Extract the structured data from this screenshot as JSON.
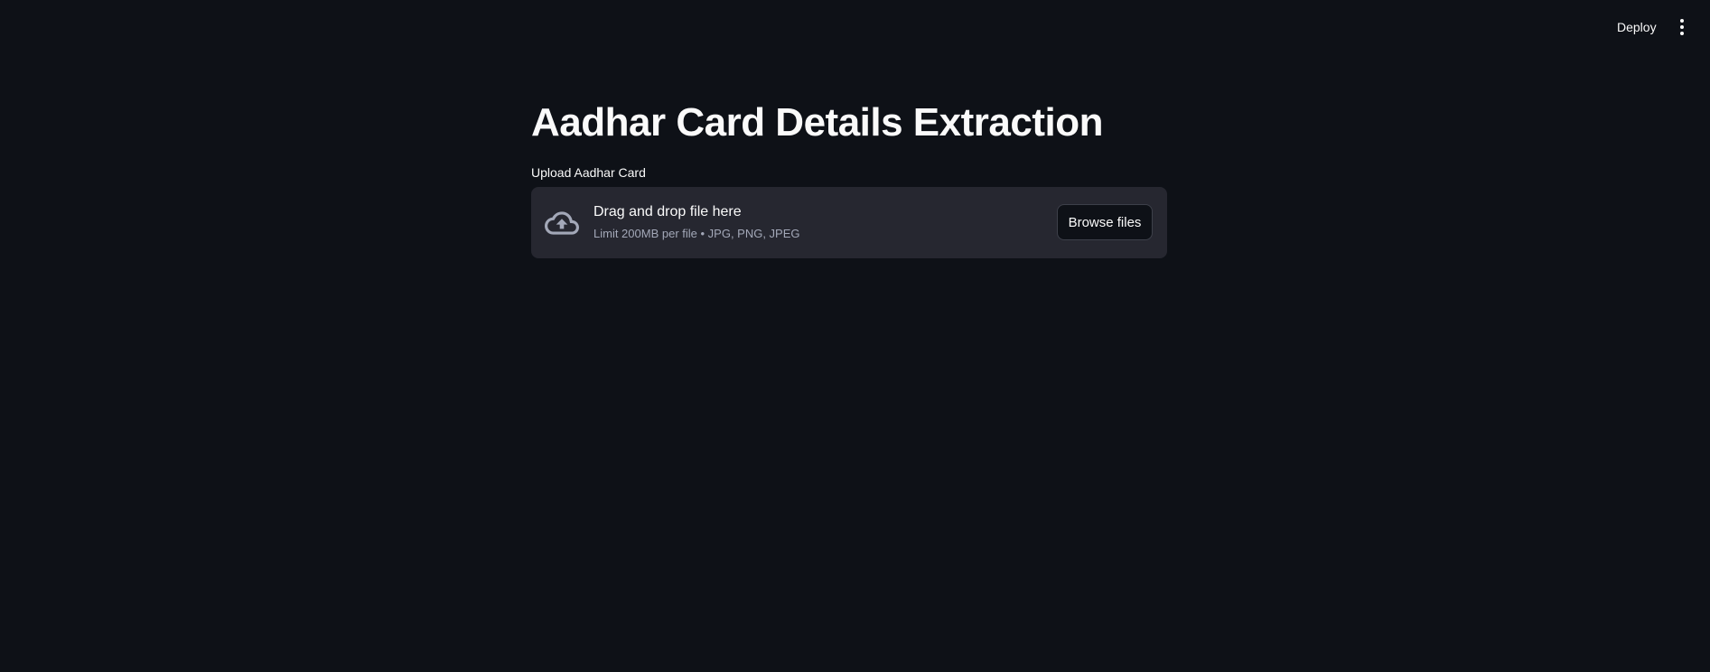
{
  "header": {
    "deploy_label": "Deploy",
    "menu_icon": "vertical-ellipsis-icon"
  },
  "main": {
    "title": "Aadhar Card Details Extraction",
    "uploader": {
      "label": "Upload Aadhar Card",
      "icon": "cloud-upload-icon",
      "drop_text": "Drag and drop file here",
      "limit_text": "Limit 200MB per file • JPG, PNG, JPEG",
      "browse_label": "Browse files"
    }
  },
  "colors": {
    "background": "#0e1117",
    "dropzone_background": "#262730",
    "text": "#fafafa",
    "muted_text": "#a3a8b8",
    "button_border": "#3d404a"
  }
}
